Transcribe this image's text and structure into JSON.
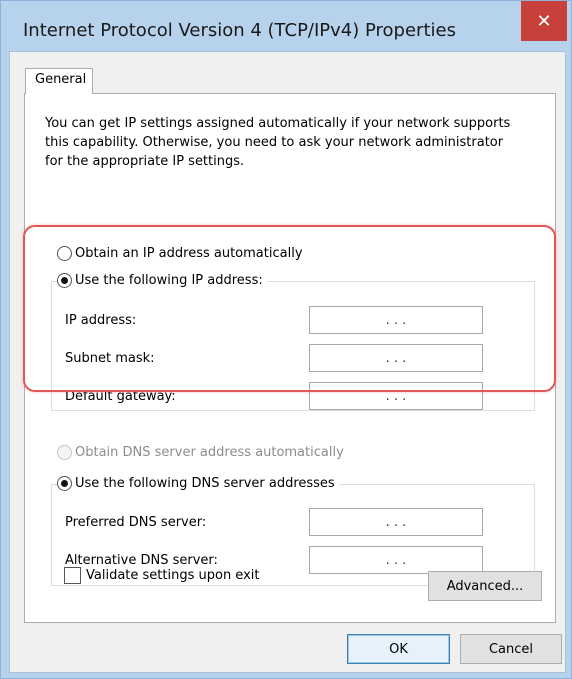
{
  "window": {
    "title": "Internet Protocol Version 4 (TCP/IPv4) Properties",
    "close_glyph": "✕"
  },
  "tabs": [
    {
      "label": "General"
    }
  ],
  "description": "You can get IP settings assigned automatically if your network supports this capability. Otherwise, you need to ask your network administrator for the appropriate IP settings.",
  "ip_section": {
    "auto_option": {
      "label": "Obtain an IP address automatically",
      "selected": false
    },
    "manual_option": {
      "label": "Use the following IP address:",
      "selected": true
    },
    "fields": [
      {
        "label": "IP address:",
        "value": ". . ."
      },
      {
        "label": "Subnet mask:",
        "value": ". . ."
      },
      {
        "label": "Default gateway:",
        "value": ". . ."
      }
    ]
  },
  "dns_section": {
    "auto_option": {
      "label": "Obtain DNS server address automatically",
      "selected": false,
      "disabled": true
    },
    "manual_option": {
      "label": "Use the following DNS server addresses",
      "selected": true
    },
    "fields": [
      {
        "label": "Preferred DNS server:",
        "value": ". . ."
      },
      {
        "label": "Alternative DNS server:",
        "value": ". . ."
      }
    ]
  },
  "validate_checkbox": {
    "label": "Validate settings upon exit",
    "checked": false
  },
  "buttons": {
    "advanced": "Advanced...",
    "ok": "OK",
    "cancel": "Cancel"
  },
  "colors": {
    "title_bar": "#b7d2ec",
    "close_button": "#c7403a",
    "highlight": "#e35656"
  }
}
